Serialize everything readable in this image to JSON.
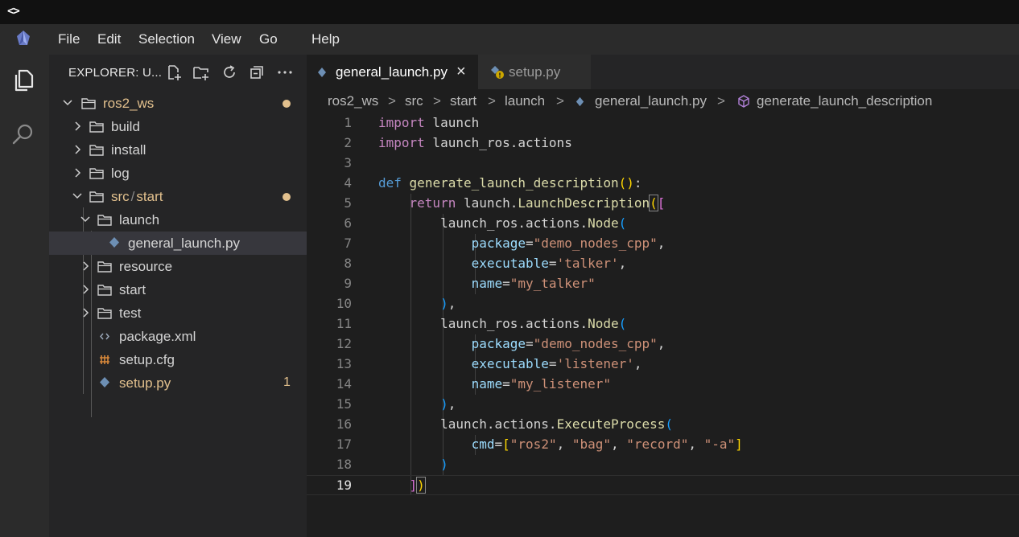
{
  "window": {
    "title_glyph": "<>"
  },
  "menu": {
    "items": [
      "File",
      "Edit",
      "Selection",
      "View",
      "Go",
      "Help"
    ]
  },
  "explorer": {
    "title": "EXPLORER: U...",
    "tree": [
      {
        "label": "ros2_ws",
        "expanded": true,
        "modified_dot": true
      },
      {
        "label": "build",
        "expanded": false
      },
      {
        "label": "install",
        "expanded": false
      },
      {
        "label": "log",
        "expanded": false
      },
      {
        "label": "src",
        "label2": "start",
        "expanded": true,
        "modified_dot": true
      },
      {
        "label": "launch",
        "expanded": true
      },
      {
        "label": "general_launch.py",
        "selected": true
      },
      {
        "label": "resource",
        "expanded": false
      },
      {
        "label": "start",
        "expanded": false
      },
      {
        "label": "test",
        "expanded": false
      },
      {
        "label": "package.xml"
      },
      {
        "label": "setup.cfg"
      },
      {
        "label": "setup.py",
        "problems": "1"
      }
    ],
    "compact_sep": "/"
  },
  "tabs": [
    {
      "label": "general_launch.py",
      "active": true,
      "close": "×"
    },
    {
      "label": "setup.py",
      "active": false,
      "warning_badge": "!"
    }
  ],
  "breadcrumb": [
    "ros2_ws",
    "src",
    "start",
    "launch",
    "general_launch.py",
    "generate_launch_description"
  ],
  "breadcrumb_sep": ">",
  "editor": {
    "current_line": 19,
    "line_numbers": [
      "1",
      "2",
      "3",
      "4",
      "5",
      "6",
      "7",
      "8",
      "9",
      "10",
      "11",
      "12",
      "13",
      "14",
      "15",
      "16",
      "17",
      "18",
      "19"
    ],
    "lines": [
      "import launch",
      "import launch_ros.actions",
      "",
      "def generate_launch_description():",
      "    return launch.LaunchDescription([",
      "        launch_ros.actions.Node(",
      "            package=\"demo_nodes_cpp\",",
      "            executable='talker',",
      "            name=\"my_talker\"",
      "        ),",
      "        launch_ros.actions.Node(",
      "            package=\"demo_nodes_cpp\",",
      "            executable='listener',",
      "            name=\"my_listener\"",
      "        ),",
      "        launch.actions.ExecuteProcess(",
      "            cmd=[\"ros2\", \"bag\", \"record\", \"-a\"]",
      "        )",
      "    ])"
    ]
  },
  "colors": {
    "keyword": "#c586c0",
    "def": "#569cd6",
    "function": "#dcdcaa",
    "variable": "#9cdcfe",
    "string": "#ce9178",
    "modified": "#e2c08d",
    "bracket_gold": "#ffd700",
    "bracket_violet": "#da70d6",
    "bracket_blue": "#179fff"
  }
}
